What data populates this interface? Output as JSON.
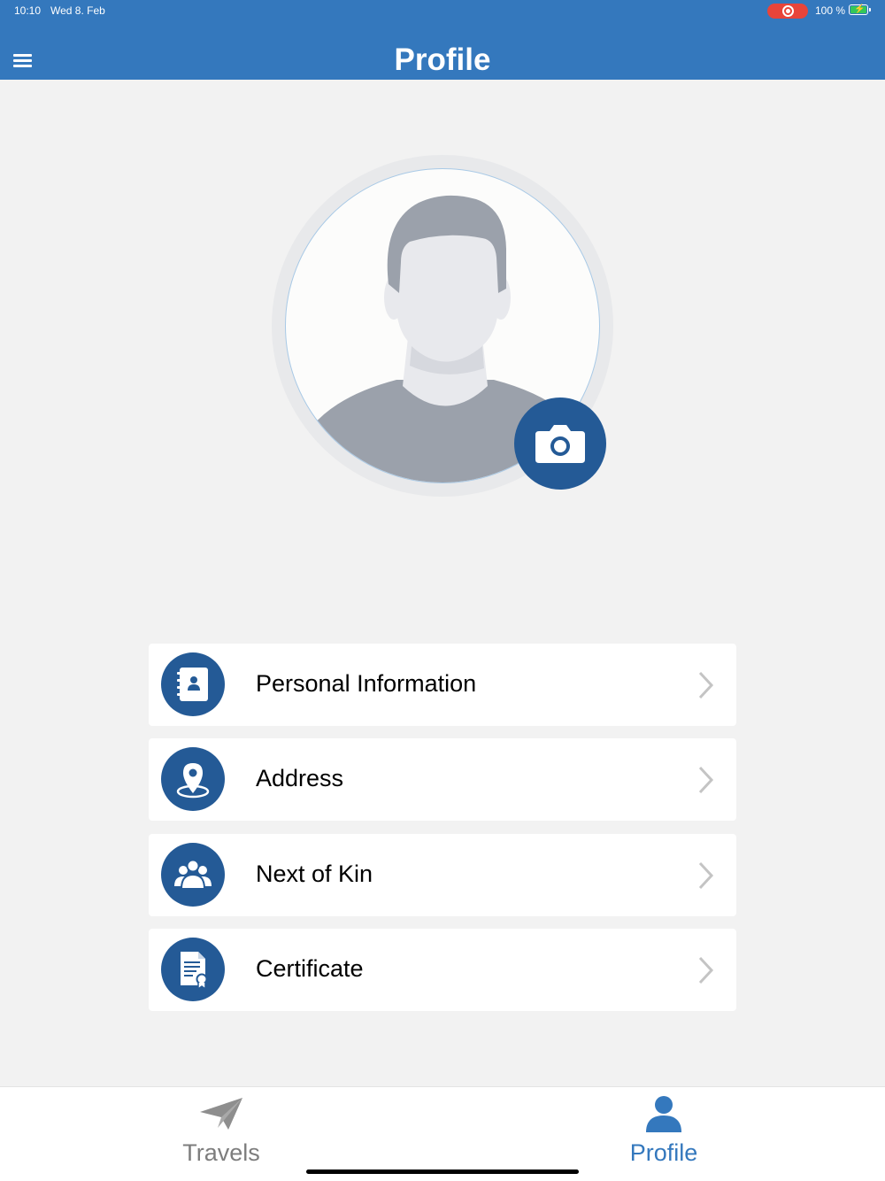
{
  "status_bar": {
    "time": "10:10",
    "date": "Wed 8. Feb",
    "battery": "100 %",
    "recording": true
  },
  "header": {
    "title": "Profile",
    "background": "#3478bd",
    "menu_icon": "hamburger-icon"
  },
  "avatar": {
    "placeholder_icon": "default-user-silhouette",
    "camera_icon": "camera-icon"
  },
  "menu": {
    "items": [
      {
        "label": "Personal Information",
        "icon": "contact-book-icon"
      },
      {
        "label": "Address",
        "icon": "location-pin-icon"
      },
      {
        "label": "Next of Kin",
        "icon": "group-icon"
      },
      {
        "label": "Certificate",
        "icon": "certificate-document-icon"
      }
    ]
  },
  "tabs": [
    {
      "label": "Travels",
      "icon": "paper-plane-icon",
      "active": false
    },
    {
      "label": "Profile",
      "icon": "person-icon",
      "active": true
    }
  ],
  "colors": {
    "accent": "#3478bd",
    "icon_bg": "#245a96",
    "inactive": "#7d7d7d",
    "background": "#f2f2f2"
  }
}
